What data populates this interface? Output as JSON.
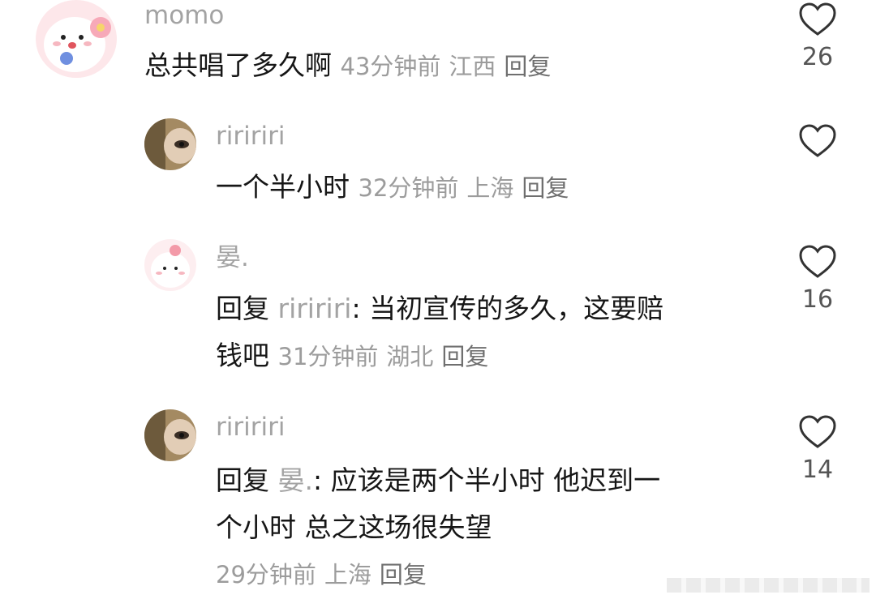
{
  "comments": [
    {
      "username": "momo",
      "text": "总共唱了多久啊",
      "time": "43分钟前",
      "location": "江西",
      "reply_label": "回复",
      "likes": "26"
    },
    {
      "username": "riririri",
      "text": "一个半小时",
      "time": "32分钟前",
      "location": "上海",
      "reply_label": "回复",
      "likes": ""
    },
    {
      "username": "晏.",
      "reply_prefix": "回复",
      "reply_to": "riririri",
      "text_line1": "当初宣传的多久，这要赔",
      "text_line2": "钱吧",
      "time": "31分钟前",
      "location": "湖北",
      "reply_label": "回复",
      "likes": "16"
    },
    {
      "username": "riririri",
      "reply_prefix": "回复",
      "reply_to": "晏.",
      "text_line1": "应该是两个半小时 他迟到一",
      "text_line2": "个小时 总之这场很失望",
      "time": "29分钟前",
      "location": "上海",
      "reply_label": "回复",
      "likes": "14"
    }
  ]
}
